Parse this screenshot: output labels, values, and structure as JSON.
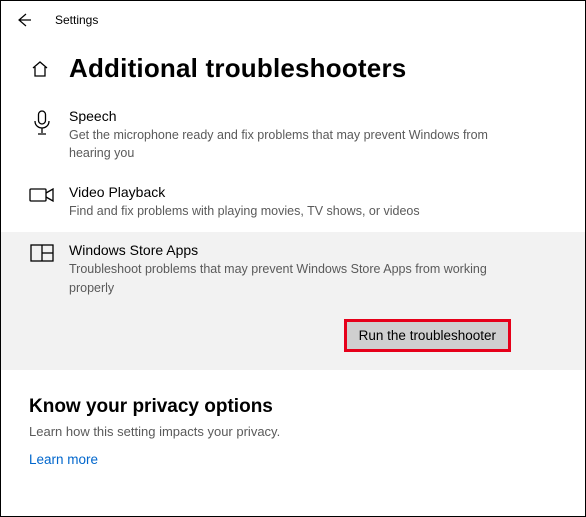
{
  "header": {
    "title": "Settings"
  },
  "page": {
    "title": "Additional troubleshooters"
  },
  "items": [
    {
      "title": "Speech",
      "desc": "Get the microphone ready and fix problems that may prevent Windows from hearing you"
    },
    {
      "title": "Video Playback",
      "desc": "Find and fix problems with playing movies, TV shows, or videos"
    },
    {
      "title": "Windows Store Apps",
      "desc": "Troubleshoot problems that may prevent Windows Store Apps from working properly"
    }
  ],
  "run_button": "Run the troubleshooter",
  "privacy": {
    "title": "Know your privacy options",
    "desc": "Learn how this setting impacts your privacy.",
    "link": "Learn more"
  }
}
